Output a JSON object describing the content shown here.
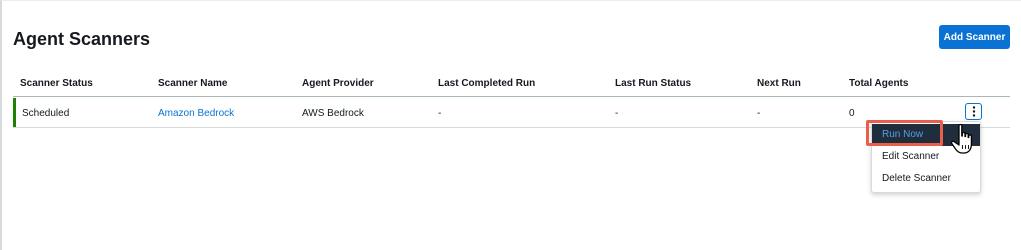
{
  "page": {
    "title": "Agent Scanners",
    "add_button_label": "Add Scanner"
  },
  "table": {
    "columns": [
      "Scanner Status",
      "Scanner Name",
      "Agent Provider",
      "Last Completed Run",
      "Last Run Status",
      "Next Run",
      "Total Agents"
    ],
    "rows": [
      {
        "status": "Scheduled",
        "name": "Amazon Bedrock",
        "provider": "AWS Bedrock",
        "last_completed_run": "-",
        "last_run_status": "-",
        "next_run": "-",
        "total_agents": "0"
      }
    ]
  },
  "actions_menu": {
    "items": [
      "Run Now",
      "Edit Scanner",
      "Delete Scanner"
    ],
    "highlighted_item": "Run Now"
  },
  "colors": {
    "primary": "#0972d3",
    "status_accent": "#1d8102",
    "highlight_box": "#e8604c",
    "active_menu_bg": "#1f2d3d"
  },
  "icons": {
    "row_actions": "vertical-ellipsis-icon",
    "cursor": "hand-pointer-icon"
  }
}
